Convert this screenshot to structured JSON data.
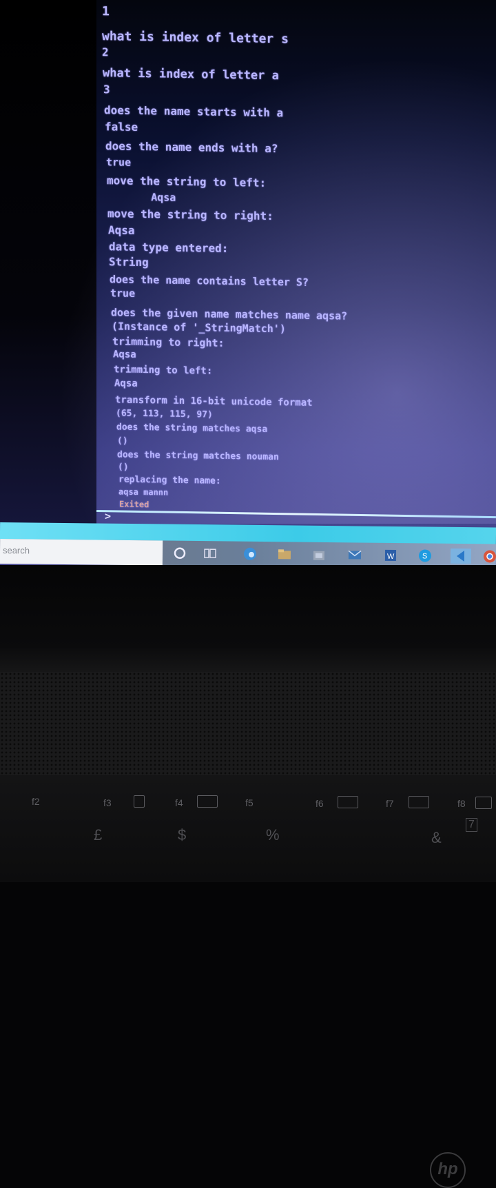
{
  "console": {
    "lines": [
      "1",
      "what is index of letter s",
      "2",
      "what is index of letter a",
      "3",
      "does the name starts with a",
      "false",
      "does the name ends with a?",
      "true",
      "move the string to left:",
      "       Aqsa",
      "move the string to right:",
      "Aqsa",
      "data type entered:",
      "String",
      "does the name contains letter S?",
      "true",
      "does the given name matches name aqsa?",
      "(Instance of '_StringMatch')",
      "trimming to right:",
      "Aqsa",
      "trimming to left:",
      "Aqsa",
      "transform in 16-bit unicode format",
      "(65, 113, 115, 97)",
      "does the string matches aqsa",
      "()",
      "does the string matches nouman",
      "()",
      "replacing the name:",
      "aqsa mannn",
      "Exited"
    ],
    "prompt": ">"
  },
  "taskbar": {
    "search_placeholder": "search"
  },
  "keyboard": {
    "fkeys": [
      "f2",
      "f3",
      "f4",
      "f5",
      "f6",
      "f7",
      "f8"
    ],
    "symbols": [
      "£",
      "$",
      "%",
      "&",
      "7"
    ]
  },
  "brand": {
    "logo": "hp"
  },
  "colors": {
    "console_text": "#b9b6ff",
    "exited_text": "#d8a3a3",
    "taskbar_accent": "#3ccbe8"
  }
}
